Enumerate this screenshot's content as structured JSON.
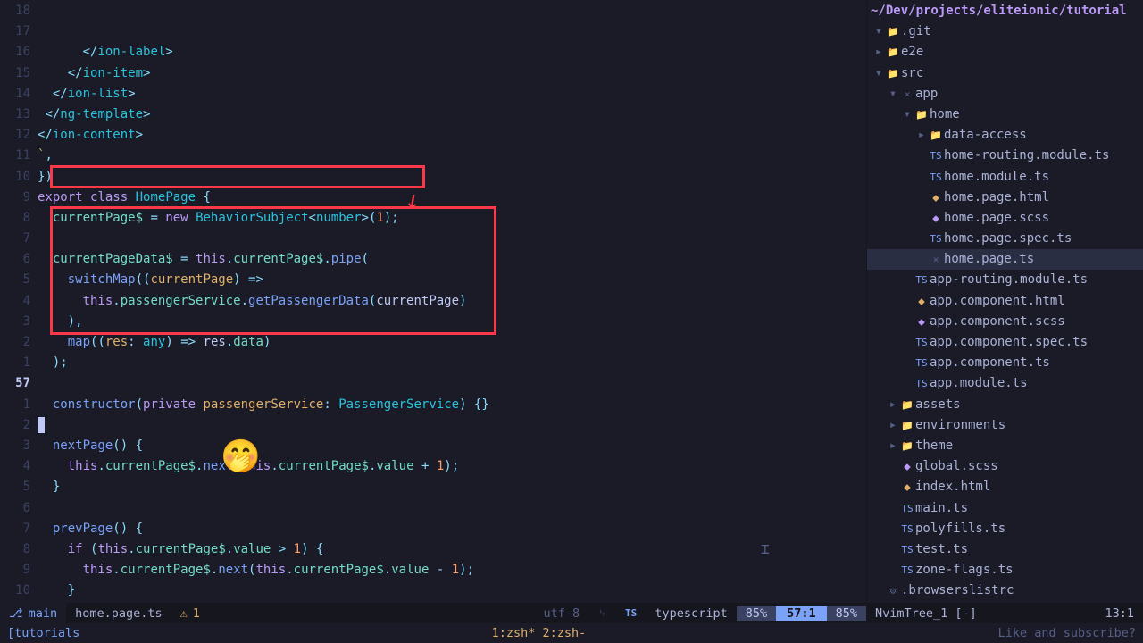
{
  "project_path": "~/Dev/projects/eliteionic/tutorial",
  "gutter": [
    "18",
    "17",
    "16",
    "15",
    "14",
    "13",
    "12",
    "11",
    "10",
    "9",
    "8",
    "7",
    "6",
    "5",
    "4",
    "3",
    "2",
    "1",
    "57",
    "1",
    "2",
    "3",
    "4",
    "5",
    "6",
    "7",
    "8",
    "9",
    "10"
  ],
  "gutter_current_index": 18,
  "code_lines": [
    {
      "html": "      <span class='punct'>&lt;/</span><span class='type'>ion-label</span><span class='punct'>&gt;</span>"
    },
    {
      "html": "    <span class='punct'>&lt;/</span><span class='type'>ion-item</span><span class='punct'>&gt;</span>"
    },
    {
      "html": "  <span class='punct'>&lt;/</span><span class='type'>ion-list</span><span class='punct'>&gt;</span>"
    },
    {
      "html": " <span class='punct'>&lt;/</span><span class='type'>ng-template</span><span class='punct'>&gt;</span>"
    },
    {
      "html": "<span class='punct'>&lt;/</span><span class='type'>ion-content</span><span class='punct'>&gt;</span>"
    },
    {
      "html": "<span class='str'>`</span><span class='punct'>,</span>"
    },
    {
      "html": "<span class='punct'>})</span>"
    },
    {
      "html": "<span class='kw'>export</span> <span class='kw'>class</span> <span class='type'>HomePage</span> <span class='punct'>{</span>"
    },
    {
      "html": "  <span class='prop'>currentPage$</span> <span class='punct'>=</span> <span class='kw'>new</span> <span class='type'>BehaviorSubject</span><span class='punct'>&lt;</span><span class='type'>number</span><span class='punct'>&gt;(</span><span class='num'>1</span><span class='punct'>);</span>"
    },
    {
      "html": ""
    },
    {
      "html": "  <span class='prop'>currentPageData$</span> <span class='punct'>=</span> <span class='kw'>this</span><span class='punct'>.</span><span class='prop'>currentPage$</span><span class='punct'>.</span><span class='fn'>pipe</span><span class='punct'>(</span>"
    },
    {
      "html": "    <span class='fn'>switchMap</span><span class='punct'>((</span><span class='param'>currentPage</span><span class='punct'>)</span> <span class='punct'>=&gt;</span>"
    },
    {
      "html": "      <span class='kw'>this</span><span class='punct'>.</span><span class='prop'>passengerService</span><span class='punct'>.</span><span class='fn'>getPassengerData</span><span class='punct'>(</span><span class='ident'>currentPage</span><span class='punct'>)</span>"
    },
    {
      "html": "    <span class='punct'>),</span>"
    },
    {
      "html": "    <span class='fn'>map</span><span class='punct'>((</span><span class='param'>res</span><span class='punct'>:</span> <span class='type'>any</span><span class='punct'>)</span> <span class='punct'>=&gt;</span> <span class='ident'>res</span><span class='punct'>.</span><span class='prop'>data</span><span class='punct'>)</span>"
    },
    {
      "html": "  <span class='punct'>);</span>"
    },
    {
      "html": ""
    },
    {
      "html": "  <span class='fn'>constructor</span><span class='punct'>(</span><span class='kw'>private</span> <span class='param'>passengerService</span><span class='punct'>:</span> <span class='type'>PassengerService</span><span class='punct'>)</span> <span class='punct'>{}</span>"
    },
    {
      "html": "<span class='cursor-block'></span>"
    },
    {
      "html": "  <span class='fn'>nextPage</span><span class='punct'>()</span> <span class='punct'>{</span>"
    },
    {
      "html": "    <span class='kw'>this</span><span class='punct'>.</span><span class='prop'>currentPage$</span><span class='punct'>.</span><span class='fn'>next</span><span class='punct'>(</span><span class='kw'>this</span><span class='punct'>.</span><span class='prop'>currentPage$</span><span class='punct'>.</span><span class='prop'>value</span> <span class='punct'>+</span> <span class='num'>1</span><span class='punct'>);</span>"
    },
    {
      "html": "  <span class='punct'>}</span>"
    },
    {
      "html": ""
    },
    {
      "html": "  <span class='fn'>prevPage</span><span class='punct'>()</span> <span class='punct'>{</span>"
    },
    {
      "html": "    <span class='kw'>if</span> <span class='punct'>(</span><span class='kw'>this</span><span class='punct'>.</span><span class='prop'>currentPage$</span><span class='punct'>.</span><span class='prop'>value</span> <span class='punct'>&gt;</span> <span class='num'>1</span><span class='punct'>)</span> <span class='punct'>{</span>"
    },
    {
      "html": "      <span class='kw'>this</span><span class='punct'>.</span><span class='prop'>currentPage$</span><span class='punct'>.</span><span class='fn'>next</span><span class='punct'>(</span><span class='kw'>this</span><span class='punct'>.</span><span class='prop'>currentPage$</span><span class='punct'>.</span><span class='prop'>value</span> <span class='punct'>-</span> <span class='num'>1</span><span class='punct'>);</span>"
    },
    {
      "html": "    <span class='punct'>}</span>"
    },
    {
      "html": "  <span class='punct'>}</span>"
    },
    {
      "html": "<span class='punct'>}</span>"
    }
  ],
  "tree": [
    {
      "depth": 0,
      "chev": "▾",
      "icon": "📁",
      "iconcls": "folder-icon",
      "label": ".git",
      "cls": ""
    },
    {
      "depth": 0,
      "chev": "▸",
      "icon": "📁",
      "iconcls": "folder-icon",
      "label": "e2e",
      "cls": ""
    },
    {
      "depth": 0,
      "chev": "▾",
      "icon": "📁",
      "iconcls": "folder-icon",
      "label": "src",
      "cls": ""
    },
    {
      "depth": 1,
      "chev": "▾",
      "icon": "✕",
      "iconcls": "file-icon",
      "label": "app",
      "cls": ""
    },
    {
      "depth": 2,
      "chev": "▾",
      "icon": "📁",
      "iconcls": "folder-icon",
      "label": "home",
      "cls": ""
    },
    {
      "depth": 3,
      "chev": "▸",
      "icon": "📁",
      "iconcls": "folder-icon",
      "label": "data-access",
      "cls": ""
    },
    {
      "depth": 3,
      "chev": " ",
      "icon": "TS",
      "iconcls": "file-icon ts",
      "label": "home-routing.module.ts",
      "cls": ""
    },
    {
      "depth": 3,
      "chev": " ",
      "icon": "TS",
      "iconcls": "file-icon ts",
      "label": "home.module.ts",
      "cls": ""
    },
    {
      "depth": 3,
      "chev": " ",
      "icon": "⬥",
      "iconcls": "file-icon html",
      "label": "home.page.html",
      "cls": ""
    },
    {
      "depth": 3,
      "chev": " ",
      "icon": "⬥",
      "iconcls": "file-icon scss",
      "label": "home.page.scss",
      "cls": ""
    },
    {
      "depth": 3,
      "chev": " ",
      "icon": "TS",
      "iconcls": "file-icon ts",
      "label": "home.page.spec.ts",
      "cls": ""
    },
    {
      "depth": 3,
      "chev": " ",
      "icon": "✕",
      "iconcls": "file-icon",
      "label": "home.page.ts",
      "cls": "active"
    },
    {
      "depth": 2,
      "chev": " ",
      "icon": "TS",
      "iconcls": "file-icon ts",
      "label": "app-routing.module.ts",
      "cls": ""
    },
    {
      "depth": 2,
      "chev": " ",
      "icon": "⬥",
      "iconcls": "file-icon html",
      "label": "app.component.html",
      "cls": ""
    },
    {
      "depth": 2,
      "chev": " ",
      "icon": "⬥",
      "iconcls": "file-icon scss",
      "label": "app.component.scss",
      "cls": ""
    },
    {
      "depth": 2,
      "chev": " ",
      "icon": "TS",
      "iconcls": "file-icon ts",
      "label": "app.component.spec.ts",
      "cls": ""
    },
    {
      "depth": 2,
      "chev": " ",
      "icon": "TS",
      "iconcls": "file-icon ts",
      "label": "app.component.ts",
      "cls": ""
    },
    {
      "depth": 2,
      "chev": " ",
      "icon": "TS",
      "iconcls": "file-icon ts",
      "label": "app.module.ts",
      "cls": ""
    },
    {
      "depth": 1,
      "chev": "▸",
      "icon": "📁",
      "iconcls": "folder-icon",
      "label": "assets",
      "cls": ""
    },
    {
      "depth": 1,
      "chev": "▸",
      "icon": "📁",
      "iconcls": "folder-icon",
      "label": "environments",
      "cls": ""
    },
    {
      "depth": 1,
      "chev": "▸",
      "icon": "📁",
      "iconcls": "folder-icon",
      "label": "theme",
      "cls": ""
    },
    {
      "depth": 1,
      "chev": " ",
      "icon": "⬥",
      "iconcls": "file-icon scss",
      "label": "global.scss",
      "cls": ""
    },
    {
      "depth": 1,
      "chev": " ",
      "icon": "⬥",
      "iconcls": "file-icon html",
      "label": "index.html",
      "cls": ""
    },
    {
      "depth": 1,
      "chev": " ",
      "icon": "TS",
      "iconcls": "file-icon ts",
      "label": "main.ts",
      "cls": ""
    },
    {
      "depth": 1,
      "chev": " ",
      "icon": "TS",
      "iconcls": "file-icon ts",
      "label": "polyfills.ts",
      "cls": ""
    },
    {
      "depth": 1,
      "chev": " ",
      "icon": "TS",
      "iconcls": "file-icon ts",
      "label": "test.ts",
      "cls": ""
    },
    {
      "depth": 1,
      "chev": " ",
      "icon": "TS",
      "iconcls": "file-icon ts",
      "label": "zone-flags.ts",
      "cls": ""
    },
    {
      "depth": 0,
      "chev": " ",
      "icon": "⚙",
      "iconcls": "file-icon",
      "label": ".browserslistrc",
      "cls": ""
    }
  ],
  "statusline": {
    "branch_icon": "⎇",
    "branch": "main",
    "filename": "home.page.ts",
    "diag_icon": "⚠",
    "diag_count": "1",
    "encoding": "utf-8",
    "lf_icon": "␊",
    "lang_icon": "TS",
    "lang": "typescript",
    "pct1": "85%",
    "position": "57:1",
    "pct2": "85%",
    "tree_label": "NvimTree_1 [-]",
    "tree_pos": "13:1"
  },
  "cmdline": {
    "left": "[tutorials",
    "center": "1:zsh*  2:zsh-",
    "right": "Like and subscribe?"
  },
  "emoji": "🤭"
}
